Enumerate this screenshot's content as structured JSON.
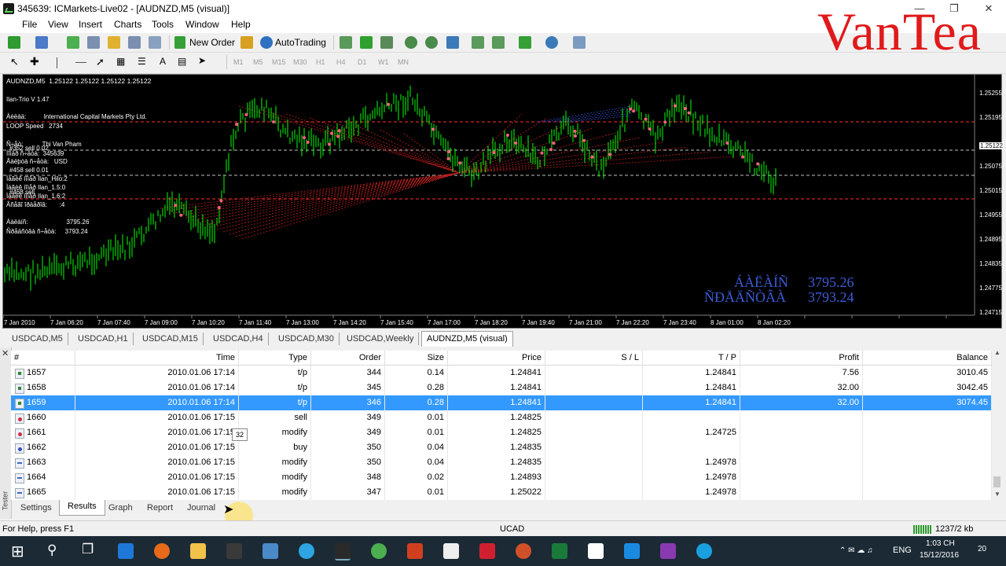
{
  "window": {
    "title": "345639: ICMarkets-Live02 - [AUDNZD,M5 (visual)]"
  },
  "menu": [
    "File",
    "View",
    "Insert",
    "Charts",
    "Tools",
    "Window",
    "Help"
  ],
  "watermark": "VanTea",
  "toolbar": {
    "new_order": "New Order",
    "autotrading": "AutoTrading",
    "timeframes": [
      "M1",
      "M5",
      "M15",
      "M30",
      "H1",
      "H4",
      "D1",
      "W1",
      "MN"
    ]
  },
  "chart": {
    "header": "AUDNZD,M5  1.25122 1.25122 1.25122 1.25122",
    "ea_name": "Ilan-Trio V 1.47",
    "info_lines": [
      "Àèëàä:          International Capital Markets Pty Ltd.",
      "LOOP Speed   2734",
      "Ñ÷åò:           Thi Van Pham",
      "#352 sell 0.02",
      "Íîìåð ñ÷åòà:  345639",
      "Âàëþòà ñ÷åòà:   USD",
      "#458 sell 0.01",
      "Ìàãèê íîìåð Ilan_Hilo:2",
      "Ìàãèê íîìåð Ilan_1.5:0",
      "Ìàãèê íîìåð Ilan_1.6:2",
      "#468 sell",
      "Âñåãî îðäåðîâ:       :4",
      "Áàëàíñ:                      3795.26",
      "Ñðåäñòâà ñ÷åòà:     3793.24"
    ],
    "balance_label": "ÁÀËÀÍÑ",
    "balance_value": "3795.26",
    "equity_label": "ÑÐÅÄÑÒÂÀ",
    "equity_value": "3793.24",
    "current_price": "1.25122",
    "price_ticks": [
      "1.25255",
      "1.25195",
      "1.25075",
      "1.25015",
      "1.24955",
      "1.24895",
      "1.24835",
      "1.24775",
      "1.24715"
    ],
    "time_ticks": [
      "7 Jan 2010",
      "7 Jan 06:20",
      "7 Jan 07:40",
      "7 Jan 09:00",
      "7 Jan 10:20",
      "7 Jan 11:40",
      "7 Jan 13:00",
      "7 Jan 14:20",
      "7 Jan 15:40",
      "7 Jan 17:00",
      "7 Jan 18:20",
      "7 Jan 19:40",
      "7 Jan 21:00",
      "7 Jan 22:20",
      "7 Jan 23:40",
      "8 Jan 01:00",
      "8 Jan 02:20"
    ]
  },
  "chart_tabs": [
    "USDCAD,M5",
    "USDCAD,H1",
    "USDCAD,M15",
    "USDCAD,H4",
    "USDCAD,M30",
    "USDCAD,Weekly",
    "AUDNZD,M5 (visual)"
  ],
  "results": {
    "columns": [
      "#",
      "Time",
      "Type",
      "Order",
      "Size",
      "Price",
      "S / L",
      "T / P",
      "Profit",
      "Balance"
    ],
    "rows": [
      {
        "icon": "tp",
        "n": "1657",
        "time": "2010.01.06 17:14",
        "type": "t/p",
        "order": "344",
        "size": "0.14",
        "price": "1.24841",
        "sl": "",
        "tp": "1.24841",
        "profit": "7.56",
        "balance": "3010.45"
      },
      {
        "icon": "tp",
        "n": "1658",
        "time": "2010.01.06 17:14",
        "type": "t/p",
        "order": "345",
        "size": "0.28",
        "price": "1.24841",
        "sl": "",
        "tp": "1.24841",
        "profit": "32.00",
        "balance": "3042.45"
      },
      {
        "icon": "tp",
        "n": "1659",
        "time": "2010.01.06 17:14",
        "type": "t/p",
        "order": "346",
        "size": "0.28",
        "price": "1.24841",
        "sl": "",
        "tp": "1.24841",
        "profit": "32.00",
        "balance": "3074.45",
        "selected": true
      },
      {
        "icon": "sell",
        "n": "1660",
        "time": "2010.01.06 17:15",
        "type": "sell",
        "order": "349",
        "size": "0.01",
        "price": "1.24825",
        "sl": "",
        "tp": "",
        "profit": "",
        "balance": ""
      },
      {
        "icon": "sell",
        "n": "1661",
        "time": "2010.01.06 17:15",
        "type": "modify",
        "order": "349",
        "size": "0.01",
        "price": "1.24825",
        "sl": "",
        "tp": "1.24725",
        "profit": "",
        "balance": ""
      },
      {
        "icon": "buy",
        "n": "1662",
        "time": "2010.01.06 17:15",
        "type": "buy",
        "order": "350",
        "size": "0.04",
        "price": "1.24835",
        "sl": "",
        "tp": "",
        "profit": "",
        "balance": ""
      },
      {
        "icon": "mod",
        "n": "1663",
        "time": "2010.01.06 17:15",
        "type": "modify",
        "order": "350",
        "size": "0.04",
        "price": "1.24835",
        "sl": "",
        "tp": "1.24978",
        "profit": "",
        "balance": ""
      },
      {
        "icon": "mod",
        "n": "1664",
        "time": "2010.01.06 17:15",
        "type": "modify",
        "order": "348",
        "size": "0.02",
        "price": "1.24893",
        "sl": "",
        "tp": "1.24978",
        "profit": "",
        "balance": ""
      },
      {
        "icon": "mod",
        "n": "1665",
        "time": "2010.01.06 17:15",
        "type": "modify",
        "order": "347",
        "size": "0.01",
        "price": "1.25022",
        "sl": "",
        "tp": "1.24978",
        "profit": "",
        "balance": ""
      }
    ],
    "tooltip": "32"
  },
  "tester_tabs": [
    "Settings",
    "Results",
    "Graph",
    "Report",
    "Journal"
  ],
  "tester_label": "Tester",
  "status": {
    "help": "For Help, press F1",
    "profile": "UCAD",
    "traffic": "1237/2 kb"
  },
  "taskbar": {
    "lang": "ENG",
    "time": "1:03 CH",
    "date": "15/12/2016",
    "notifications": "20"
  }
}
